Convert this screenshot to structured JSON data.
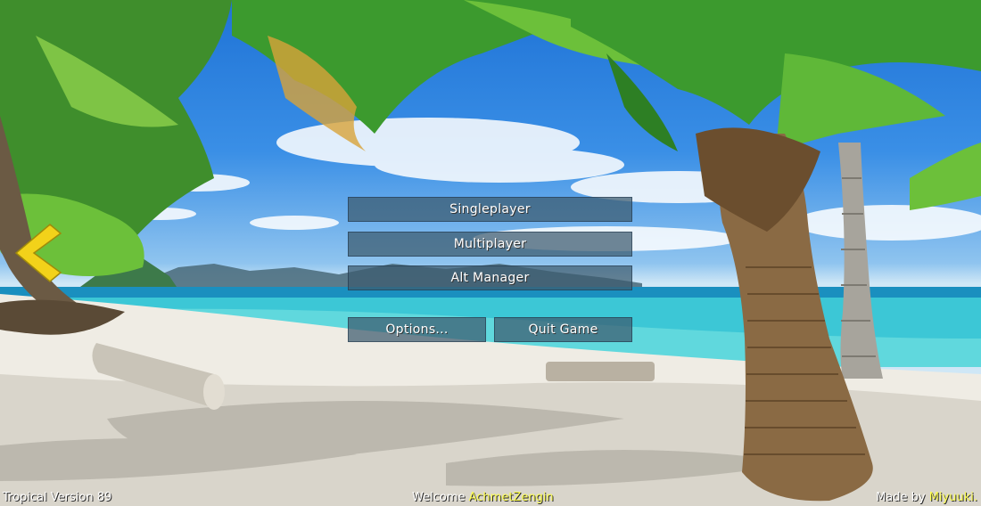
{
  "menu": {
    "singleplayer": "Singleplayer",
    "multiplayer": "Multiplayer",
    "alt_manager": "Alt Manager",
    "options": "Options...",
    "quit": "Quit Game"
  },
  "footer": {
    "version": "Tropical Version 89",
    "welcome_prefix": "Welcome",
    "username": "AchmetZengin",
    "made_by_prefix": "Made by",
    "author": "Miyuuki."
  },
  "colors": {
    "button_bg": "#3c5a6e",
    "highlight_text": "#ffff55",
    "back_arrow": "#f2d21a"
  },
  "icons": {
    "back": "chevron-left-icon"
  }
}
